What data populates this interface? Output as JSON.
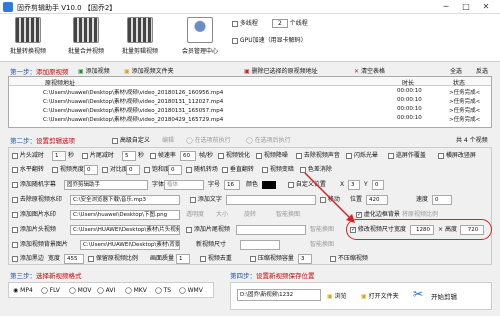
{
  "window": {
    "title": "固乔剪辑助手 V10.0 【固乔2】",
    "min": "─",
    "max": "□",
    "close": "✕"
  },
  "toolbar": {
    "buttons": [
      "批量转换视频",
      "批量合并视频",
      "批量剪辑视频",
      "会员管理中心"
    ],
    "opt1": "多线程",
    "opt1_num": "2",
    "opt1_suffix": "个线程",
    "opt2": "GPU加速（用显卡解码）"
  },
  "step1": {
    "label": "第一步：",
    "title": "添加原视频",
    "add": "添加视频",
    "add_folder": "添加视频文件夹",
    "delete": "删除已选择的原视频地址",
    "clear": "清空表格",
    "select_all": "全选",
    "inverse": "反选"
  },
  "table": {
    "headers": [
      "原视频地址",
      "时长",
      "状态"
    ],
    "rows": [
      {
        "path": "C:\\Users\\huawei\\Desktop\\素材\\视频\\video_20180126_160956.mp4",
        "dur": "00:00:10",
        "status": ">任务完成<"
      },
      {
        "path": "C:\\Users\\huawei\\Desktop\\素材\\视频\\video_20180131_112027.mp4",
        "dur": "00:00:10",
        "status": ">任务完成<"
      },
      {
        "path": "C:\\Users\\huawei\\Desktop\\素材\\视频\\video_20180131_165057.mp4",
        "dur": "00:00:10",
        "status": ">任务完成<"
      },
      {
        "path": "C:\\Users\\huawei\\Desktop\\素材\\视频\\video_20180429_165729.mp4",
        "dur": "00:00:10",
        "status": ">任务完成<"
      }
    ],
    "count": "共 4 个视频"
  },
  "step2": {
    "label": "第二步：",
    "title": "设置剪辑选项",
    "opt_custom": "高级自定义",
    "opt_edit": "编辑",
    "opt_exec_a": "在选项前执行",
    "opt_exec_b": "在选项后执行"
  },
  "opts": {
    "r1": [
      "片头减时",
      "秒",
      "片尾减时",
      "秒",
      "帧速率",
      "帧/秒",
      "视频锐化",
      "视频降噪",
      "去除视频声音",
      "闪烁光晕",
      "巡屏作覆盖",
      "横屏改竖屏"
    ],
    "r1v": [
      "1",
      "5",
      "60"
    ],
    "r2": [
      "水平翻转",
      "视频亮度",
      "对比度",
      "饱和度",
      "随机转场",
      "垂直翻转",
      "视频变暗",
      "色差消除"
    ],
    "r2v": [
      "0",
      "0",
      "0"
    ],
    "r3": [
      "添加随机字幕",
      "固乔剪辑助手",
      "字体",
      "字号",
      "颜色",
      "自定义位置",
      "X",
      "Y"
    ],
    "r3v": [
      "楷体",
      "16",
      "3",
      "0"
    ],
    "r4": [
      "去除原视频水印",
      "添加文字",
      "移动",
      "位置",
      "速度"
    ],
    "r4v": [
      "C:\\安全浏览器下载\\音乐.mp3",
      "420",
      "0"
    ],
    "r5": [
      "添加图片水印",
      "C:\\Users\\huawei\\Desktop\\下图.png",
      "透明度",
      "大小",
      "旋转",
      "智能换图"
    ],
    "r6": [
      "添加片头视频",
      "C:\\Users\\HUAWEI\\Desktop\\素材\\片头视频",
      "添加片尾视频",
      "智能换图"
    ],
    "r7": [
      "添加视频背景图片",
      "C:\\Users\\HUAWEI\\Desktop\\素材\\背景图",
      "新视频尺寸",
      "智能换图"
    ],
    "r8": [
      "添加黑边",
      "宽度",
      "保留原视频比例",
      "画面质量",
      "视频去重",
      "压缩视频容量",
      "不压缩视频"
    ],
    "r8v": [
      "455",
      "1",
      "3"
    ],
    "resize": {
      "label": "修改视频尺寸",
      "width_label": "宽度",
      "width": "1280",
      "height_label": "高度",
      "height": "720",
      "aspect": "虚化边框背景",
      "aspect2": "将原视频比例"
    }
  },
  "step3": {
    "label": "第三步：",
    "title": "选择新视频格式",
    "formats": [
      "MP4",
      "FLV",
      "MOV",
      "AVI",
      "MKV",
      "TS",
      "WMV"
    ],
    "selected": "MP4"
  },
  "step4": {
    "label": "第四步：",
    "title": "设置新视频保存位置",
    "path": "D:\\固乔\\新视频\\1232",
    "browse": "浏览",
    "open_folder": "打开文件夹",
    "start": "开始剪辑"
  },
  "colors": {
    "accent": "#2d7be0",
    "section_red": "#c00000",
    "highlight": "#e02020"
  }
}
